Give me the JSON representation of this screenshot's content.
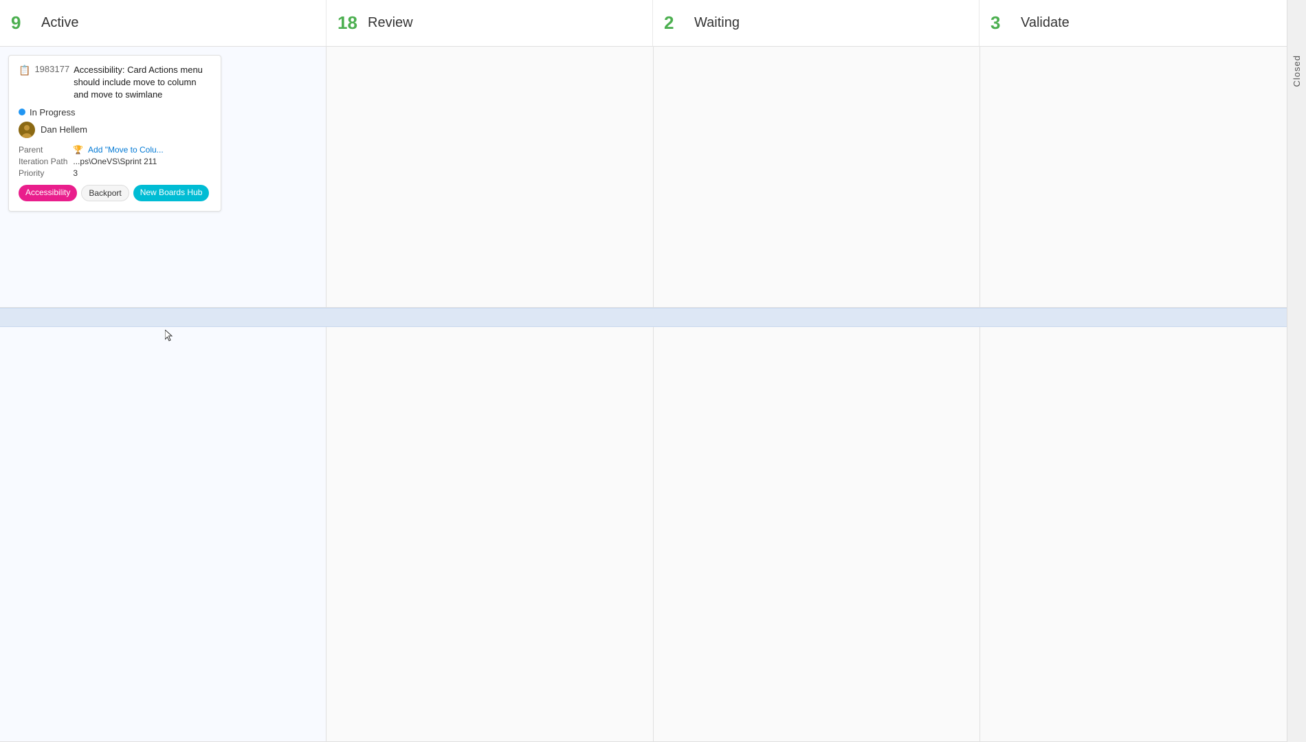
{
  "columns": [
    {
      "id": "active",
      "title": "Active",
      "count": "9"
    },
    {
      "id": "review",
      "title": "Review",
      "count": "18"
    },
    {
      "id": "waiting",
      "title": "Waiting",
      "count": "2"
    },
    {
      "id": "validate",
      "title": "Validate",
      "count": "3"
    }
  ],
  "nav": {
    "next_arrow": "›"
  },
  "card": {
    "icon": "📋",
    "id": "1983177",
    "title": "Accessibility: Card Actions menu should include move to column and move to swimlane",
    "status": "In Progress",
    "assignee": "Dan Hellem",
    "parent_label": "Parent",
    "parent_value": "Add \"Move to Colu...",
    "iteration_label": "Iteration Path",
    "iteration_value": "...ps\\OneVS\\Sprint 211",
    "priority_label": "Priority",
    "priority_value": "3",
    "tags": [
      "Accessibility",
      "Backport",
      "New Boards Hub"
    ]
  },
  "closed_sidebar": {
    "label": "Closed"
  },
  "colors": {
    "count_green": "#4caf50",
    "status_blue": "#2196f3",
    "tag_pink": "#e91e8c",
    "tag_cyan": "#00bcd4",
    "parent_link": "#0078d4"
  }
}
